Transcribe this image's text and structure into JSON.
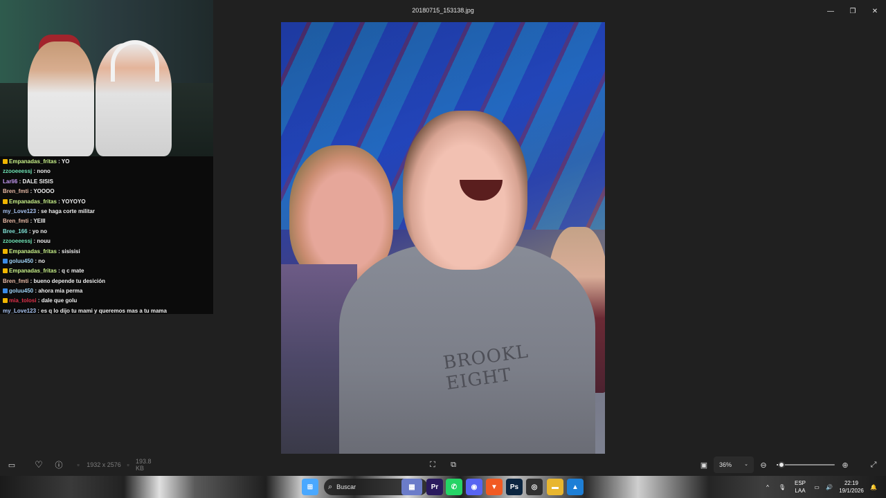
{
  "window": {
    "title": "20180715_153138.jpg",
    "minimize_glyph": "—",
    "maximize_glyph": "❐",
    "close_glyph": "✕"
  },
  "photo": {
    "shirt_print": "BROOKL EIGHT"
  },
  "chat": [
    {
      "user": "Empanadas_fritas",
      "color": "#c9f28a",
      "badge": "gold",
      "text": "YO"
    },
    {
      "user": "zzooeeessj",
      "color": "#6fe3b5",
      "badge": "",
      "text": "nono"
    },
    {
      "user": "Larli6",
      "color": "#c79bf5",
      "badge": "",
      "text": "DALE SISIS"
    },
    {
      "user": "Bren_fmti",
      "color": "#e7b9a5",
      "badge": "",
      "text": "YOOOO"
    },
    {
      "user": "Empanadas_fritas",
      "color": "#c9f28a",
      "badge": "gold",
      "text": "YOYOYO"
    },
    {
      "user": "my_Love123",
      "color": "#a9c4f2",
      "badge": "",
      "text": "se haga corte militar"
    },
    {
      "user": "Bren_fmti",
      "color": "#e7b9a5",
      "badge": "",
      "text": "YEIII"
    },
    {
      "user": "Bree_166",
      "color": "#7fe0d4",
      "badge": "",
      "text": "yo no"
    },
    {
      "user": "zzooeeessj",
      "color": "#6fe3b5",
      "badge": "",
      "text": "nouu"
    },
    {
      "user": "Empanadas_fritas",
      "color": "#c9f28a",
      "badge": "gold",
      "text": "sisisisi"
    },
    {
      "user": "goluu450",
      "color": "#9fd2f5",
      "badge": "blue",
      "text": "no"
    },
    {
      "user": "Empanadas_fritas",
      "color": "#c9f28a",
      "badge": "gold",
      "text": "q c mate"
    },
    {
      "user": "Bren_fmti",
      "color": "#e7b9a5",
      "badge": "",
      "text": "bueno depende tu desición"
    },
    {
      "user": "goluu450",
      "color": "#9fd2f5",
      "badge": "blue",
      "text": "ahora mia perma"
    },
    {
      "user": "mia_tolosi",
      "color": "#e0314a",
      "badge": "gold",
      "text": "dale que golu"
    },
    {
      "user": "my_Love123",
      "color": "#a9c4f2",
      "badge": "",
      "text": "es q lo dijo tu mami y queremos mas a tu mama"
    }
  ],
  "toolbar": {
    "filmstrip_icon": "▭",
    "favorite_icon": "♡",
    "info_icon": "ⓘ",
    "dimensions": "1932 x 2576",
    "filesize": "193.8 KB",
    "zoom": "36%",
    "zoom_level": 0.08,
    "zoom_out_glyph": "⊖",
    "zoom_in_glyph": "⊕",
    "expand_glyph": "⤢"
  },
  "taskbar": {
    "search_placeholder": "Buscar",
    "language": "ESP",
    "language_sub": "LAA",
    "time": "22:19",
    "date": "19/1/2026",
    "apps": [
      {
        "name": "windows-start-icon",
        "glyph": "⊞",
        "color": "#4aa8ff"
      },
      {
        "name": "video-thumbnail-icon",
        "glyph": "▦",
        "color": "#6b7cc9"
      },
      {
        "name": "premiere-icon",
        "glyph": "Pr",
        "color": "#2a1a5e"
      },
      {
        "name": "whatsapp-icon",
        "glyph": "✆",
        "color": "#25d366"
      },
      {
        "name": "discord-icon",
        "glyph": "◉",
        "color": "#5865f2"
      },
      {
        "name": "brave-icon",
        "glyph": "▼",
        "color": "#f15a22"
      },
      {
        "name": "photoshop-icon",
        "glyph": "Ps",
        "color": "#0b2540"
      },
      {
        "name": "obs-icon",
        "glyph": "◎",
        "color": "#303030"
      },
      {
        "name": "file-explorer-icon",
        "glyph": "▬",
        "color": "#e8b62f"
      },
      {
        "name": "photos-app-icon",
        "glyph": "▲",
        "color": "#1e7fd6"
      }
    ]
  }
}
